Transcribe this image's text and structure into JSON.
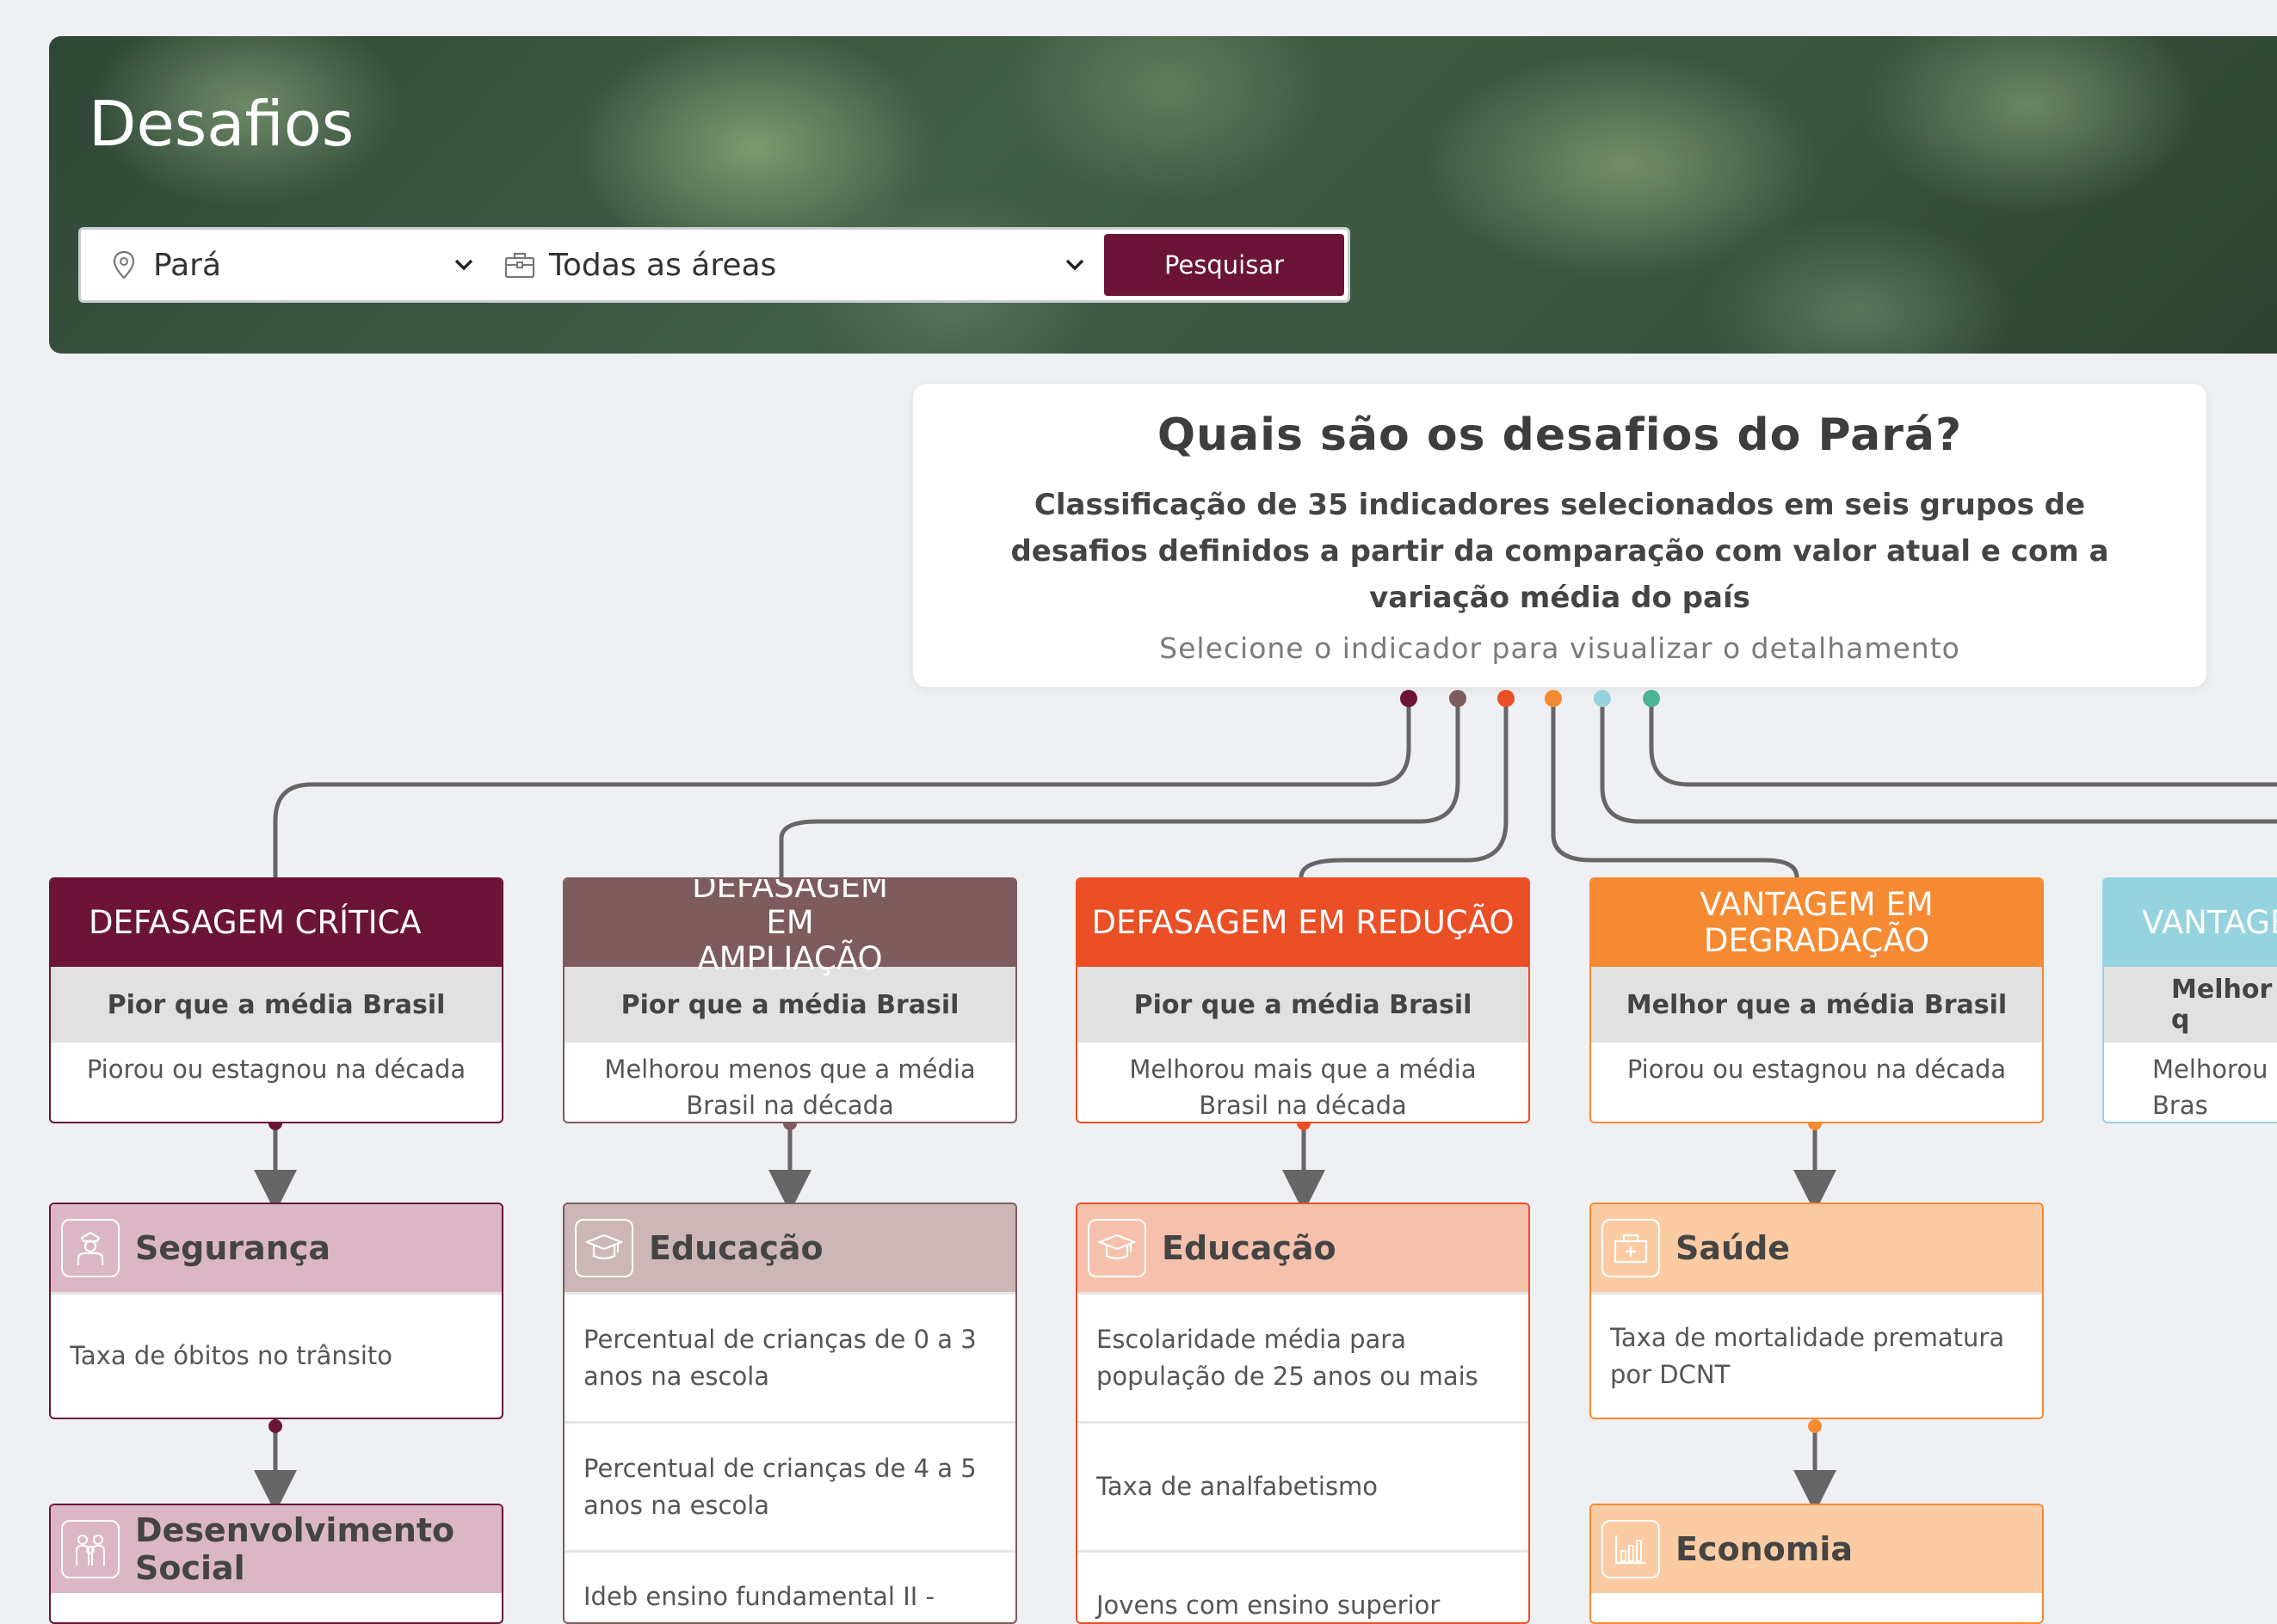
{
  "header": {
    "title": "Desafios"
  },
  "search": {
    "location": "Pará",
    "area": "Todas as áreas",
    "button_label": "Pesquisar",
    "location_icon": "map-pin-icon",
    "area_icon": "briefcase-icon"
  },
  "intro": {
    "title": "Quais são os desafios do Pará?",
    "description": "Classificação de 35 indicadores selecionados em seis grupos de desafios definidos a partir da comparação com valor atual e com a variação média do país",
    "hint": "Selecione o indicador para visualizar o detalhamento"
  },
  "colors": {
    "critica": "#6b1437",
    "ampliacao": "#7e5b5d",
    "reducao": "#ea4f25",
    "degradacao": "#f68a33",
    "vantagem": "#95d3de",
    "green": "#4bb395",
    "brand_button": "#6b1437"
  },
  "groups": [
    {
      "title": "DEFASAGEM CRÍTICA",
      "comparison": "Pior que a média Brasil",
      "variation": "Piorou ou estagnou na década"
    },
    {
      "title": "DEFASAGEM EM AMPLIAÇÃO",
      "comparison": "Pior que a média Brasil",
      "variation": "Melhorou menos que a média Brasil na década"
    },
    {
      "title": "DEFASAGEM EM REDUÇÃO",
      "comparison": "Pior que a média Brasil",
      "variation": "Melhorou mais que a média Brasil na década"
    },
    {
      "title": "VANTAGEM EM DEGRADAÇÃO",
      "comparison": "Melhor que a média Brasil",
      "variation": "Piorou ou estagnou na década"
    },
    {
      "title": "VANTAGE",
      "comparison": "Melhor q",
      "variation": "Melhorou  Bras"
    }
  ],
  "areas": {
    "seguranca": {
      "name": "Segurança",
      "icon": "police-officer-icon",
      "indicators": [
        "Taxa de óbitos no trânsito"
      ]
    },
    "desenvolvimento_social": {
      "name": "Desenvolvimento Social",
      "icon": "family-icon",
      "indicators": []
    },
    "educacao_ampliacao": {
      "name": "Educação",
      "icon": "graduation-cap-icon",
      "indicators": [
        "Percentual de crianças de 0 a 3 anos na escola",
        "Percentual de crianças de 4 a 5 anos na escola",
        "Ideb ensino fundamental II - rede"
      ]
    },
    "educacao_reducao": {
      "name": "Educação",
      "icon": "graduation-cap-icon",
      "indicators": [
        "Escolaridade média para população de 25 anos ou mais",
        "Taxa de analfabetismo",
        "Jovens com ensino superior"
      ]
    },
    "saude": {
      "name": "Saúde",
      "icon": "hospital-icon",
      "indicators": [
        "Taxa de mortalidade prematura por DCNT"
      ]
    },
    "economia": {
      "name": "Economia",
      "icon": "bar-chart-icon",
      "indicators": []
    }
  }
}
